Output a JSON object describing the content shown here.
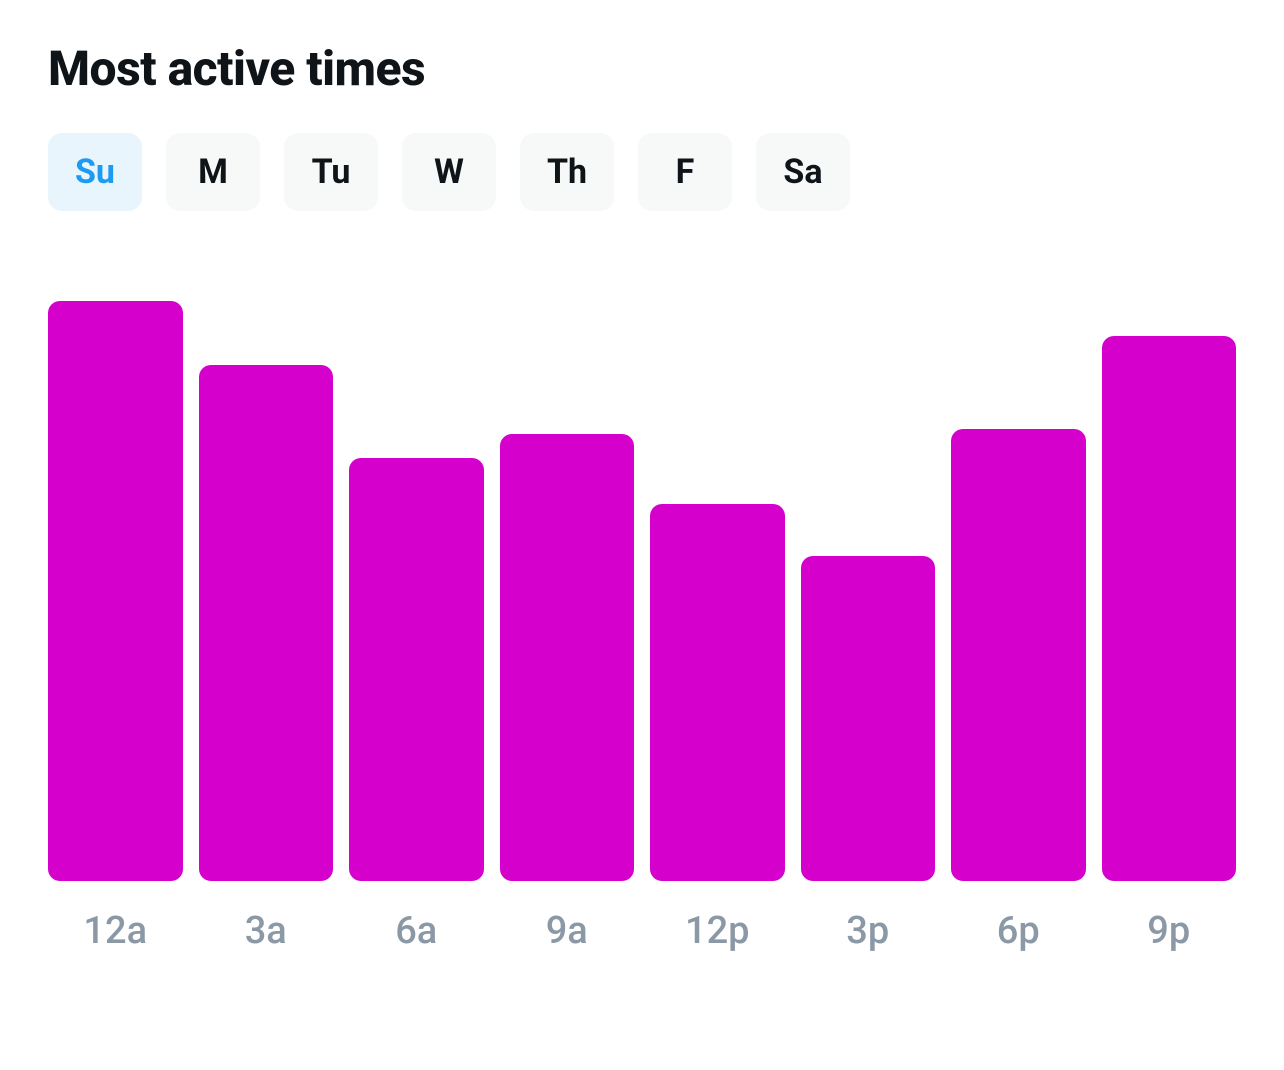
{
  "title": "Most active times",
  "days": [
    {
      "key": "su",
      "label": "Su",
      "active": true
    },
    {
      "key": "m",
      "label": "M",
      "active": false
    },
    {
      "key": "tu",
      "label": "Tu",
      "active": false
    },
    {
      "key": "w",
      "label": "W",
      "active": false
    },
    {
      "key": "th",
      "label": "Th",
      "active": false
    },
    {
      "key": "f",
      "label": "F",
      "active": false
    },
    {
      "key": "sa",
      "label": "Sa",
      "active": false
    }
  ],
  "colors": {
    "bar": "#d600cc",
    "tab_active_bg": "#e8f5fd",
    "tab_active_text": "#1d9bf0",
    "tab_bg": "#f7f9f9",
    "muted": "#8b98a5"
  },
  "chart_data": {
    "type": "bar",
    "title": "Most active times",
    "xlabel": "",
    "ylabel": "",
    "ylim": [
      0,
      100
    ],
    "categories": [
      "12a",
      "3a",
      "6a",
      "9a",
      "12p",
      "3p",
      "6p",
      "9p"
    ],
    "values": [
      100,
      89,
      73,
      77,
      65,
      56,
      78,
      94
    ]
  }
}
